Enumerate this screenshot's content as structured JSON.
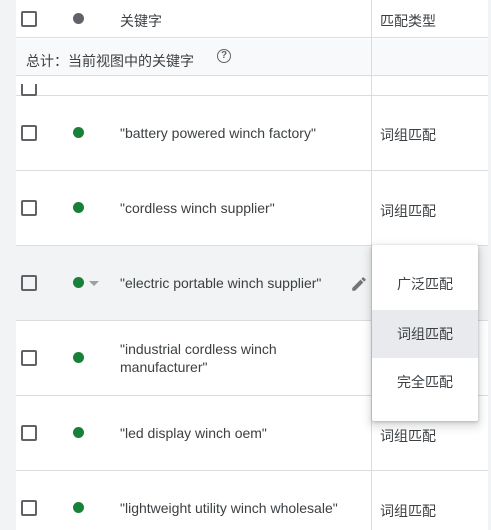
{
  "header": {
    "keyword_col": "关键字",
    "match_col": "匹配类型"
  },
  "summary": {
    "text": "总计：当前视图中的关键字",
    "help_icon": "?"
  },
  "rows": [
    {
      "keyword": "\"battery powered winch factory\"",
      "match": "词组匹配"
    },
    {
      "keyword": "\"cordless winch supplier\"",
      "match": "词组匹配"
    },
    {
      "keyword": "\"electric portable winch supplier\"",
      "match": ""
    },
    {
      "keyword": "\"industrial cordless winch manufacturer\"",
      "match": ""
    },
    {
      "keyword": "\"led display winch oem\"",
      "match": "词组匹配"
    },
    {
      "keyword": "\"lightweight utility winch wholesale\"",
      "match": "词组匹配"
    }
  ],
  "match_menu": {
    "options": [
      "广泛匹配",
      "词组匹配",
      "完全匹配"
    ],
    "selected": "词组匹配"
  },
  "colors": {
    "status_enabled": "#188038",
    "status_header": "#5f6368",
    "selected_bg": "#e8eaed"
  }
}
